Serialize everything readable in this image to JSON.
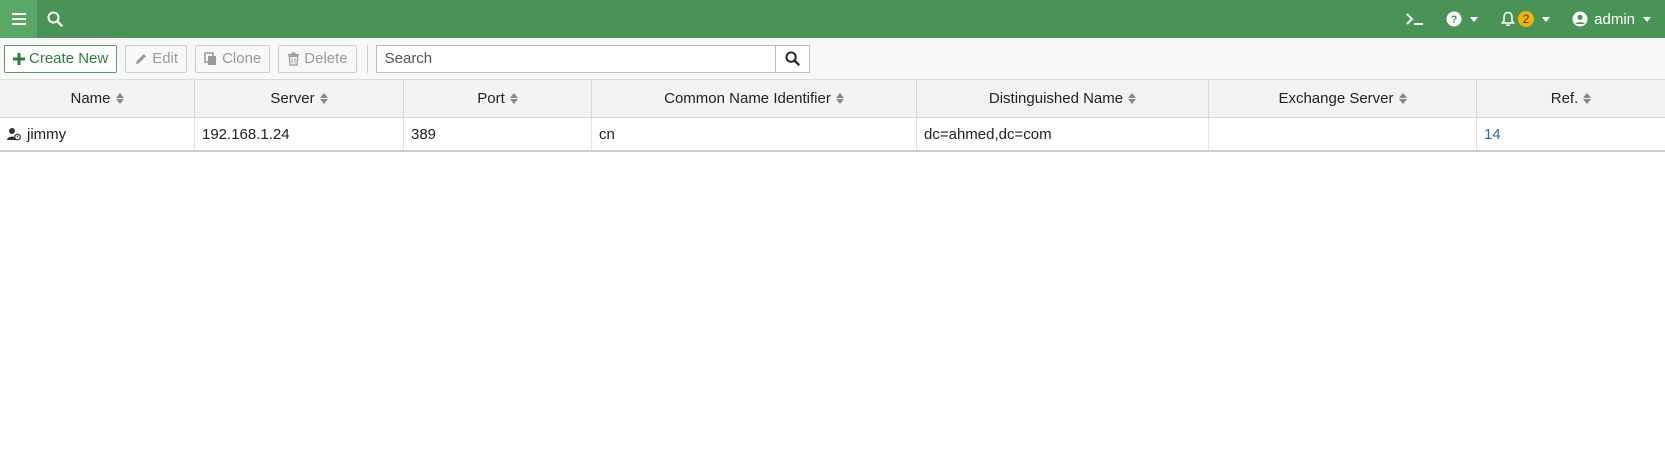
{
  "colors": {
    "topbar": "#4a9356",
    "menu_button": "#5aa866",
    "primary_text": "#2f7d3a",
    "link": "#2a6ab0",
    "badge": "#f4b400"
  },
  "topbar": {
    "menu_icon": "hamburger-icon",
    "search_icon": "search-icon",
    "cli_icon": "terminal-icon",
    "help_icon": "question-circle-icon",
    "notifications_icon": "bell-icon",
    "notifications_count": "2",
    "user_icon": "user-circle-icon",
    "user_label": "admin"
  },
  "toolbar": {
    "create_new_label": "Create New",
    "edit_label": "Edit",
    "clone_label": "Clone",
    "delete_label": "Delete",
    "search_placeholder": "Search"
  },
  "table": {
    "columns": [
      "Name",
      "Server",
      "Port",
      "Common Name Identifier",
      "Distinguished Name",
      "Exchange Server",
      "Ref."
    ],
    "rows": [
      {
        "name": "jimmy",
        "server": "192.168.1.24",
        "port": "389",
        "common_name_identifier": "cn",
        "distinguished_name": "dc=ahmed,dc=com",
        "exchange_server": "",
        "ref": "14"
      }
    ]
  }
}
